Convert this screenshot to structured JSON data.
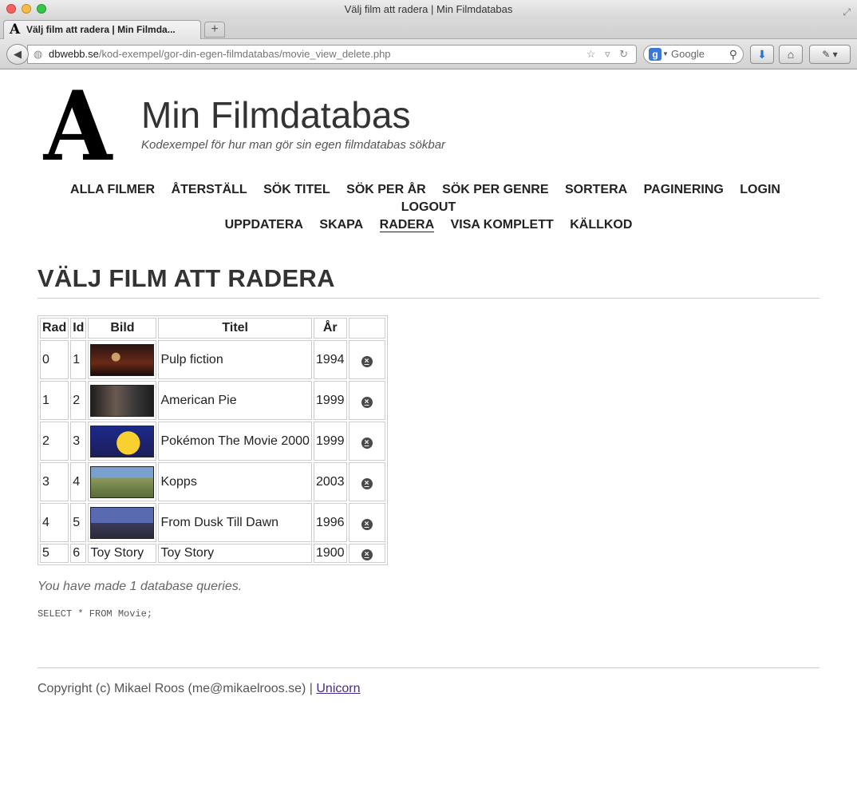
{
  "window": {
    "title": "Välj film att radera | Min Filmdatabas"
  },
  "tab": {
    "label": "Välj film att radera | Min Filmda..."
  },
  "browser": {
    "url_host": "dbwebb.se",
    "url_path": "/kod-exempel/gor-din-egen-filmdatabas/movie_view_delete.php",
    "search_placeholder": "Google"
  },
  "site": {
    "logo_letter": "A",
    "title": "Min Filmdatabas",
    "slogan": "Kodexempel för hur man gör sin egen filmdatabas sökbar"
  },
  "menu": [
    {
      "label": "ALLA FILMER",
      "selected": false
    },
    {
      "label": "ÅTERSTÄLL",
      "selected": false
    },
    {
      "label": "SÖK TITEL",
      "selected": false
    },
    {
      "label": "SÖK PER ÅR",
      "selected": false
    },
    {
      "label": "SÖK PER GENRE",
      "selected": false
    },
    {
      "label": "SORTERA",
      "selected": false
    },
    {
      "label": "PAGINERING",
      "selected": false
    },
    {
      "label": "LOGIN",
      "selected": false
    },
    {
      "label": "LOGOUT",
      "selected": false
    },
    {
      "label": "UPPDATERA",
      "selected": false
    },
    {
      "label": "SKAPA",
      "selected": false
    },
    {
      "label": "RADERA",
      "selected": true
    },
    {
      "label": "VISA KOMPLETT",
      "selected": false
    },
    {
      "label": "KÄLLKOD",
      "selected": false
    }
  ],
  "heading": "VÄLJ FILM ATT RADERA",
  "table": {
    "headers": [
      "Rad",
      "Id",
      "Bild",
      "Titel",
      "År",
      ""
    ],
    "rows": [
      {
        "rad": "0",
        "id": "1",
        "image": "pulp-fiction-thumb",
        "title": "Pulp fiction",
        "year": "1994"
      },
      {
        "rad": "1",
        "id": "2",
        "image": "american-pie-thumb",
        "title": "American Pie",
        "year": "1999"
      },
      {
        "rad": "2",
        "id": "3",
        "image": "pokemon-thumb",
        "title": "Pokémon The Movie 2000",
        "year": "1999"
      },
      {
        "rad": "3",
        "id": "4",
        "image": "kopps-thumb",
        "title": "Kopps",
        "year": "2003"
      },
      {
        "rad": "4",
        "id": "5",
        "image": "from-dusk-thumb",
        "title": "From Dusk Till Dawn",
        "year": "1996"
      },
      {
        "rad": "5",
        "id": "6",
        "image_alt": "Toy Story",
        "title": "Toy Story",
        "year": "1900"
      }
    ]
  },
  "queries_note": "You have made 1 database queries.",
  "sql": "SELECT * FROM Movie;",
  "footer": {
    "text": "Copyright (c) Mikael Roos (me@mikaelroos.se) | ",
    "link": "Unicorn"
  }
}
